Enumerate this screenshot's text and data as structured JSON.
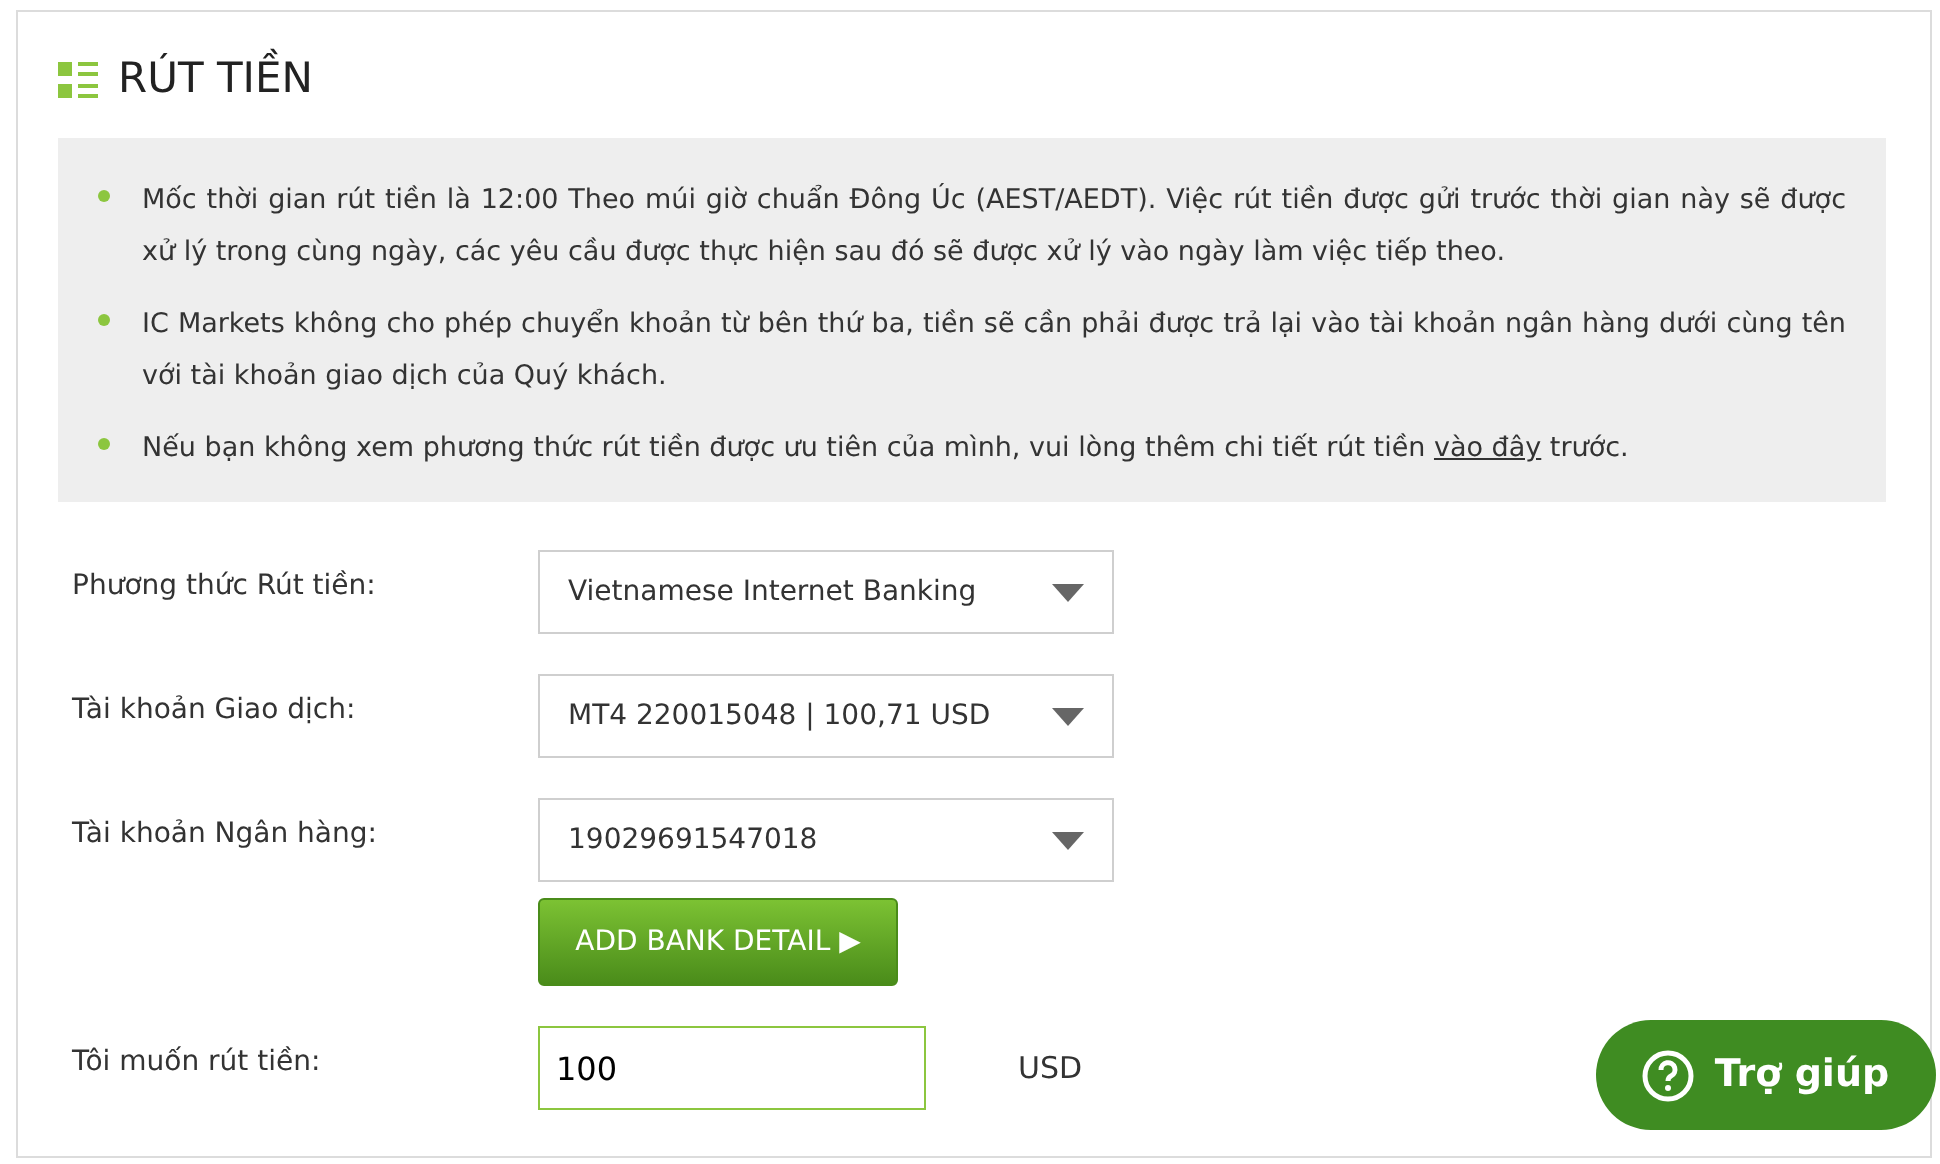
{
  "title": "RÚT TIỀN",
  "notes": [
    {
      "text": "Mốc thời gian rút tiền là 12:00 Theo múi giờ chuẩn Đông Úc (AEST/AEDT). Việc rút tiền được gửi trước thời gian này sẽ được xử lý trong cùng ngày, các yêu cầu được thực hiện sau đó sẽ được xử lý vào ngày làm việc tiếp theo."
    },
    {
      "text": "IC Markets không cho phép chuyển khoản từ bên thứ ba, tiền sẽ cần phải được trả lại vào tài khoản ngân hàng dưới cùng tên với tài khoản giao dịch của Quý khách."
    },
    {
      "text": "Nếu bạn không xem phương thức rút tiền được ưu tiên của mình, vui lòng thêm chi tiết rút tiền ",
      "link": "vào đây",
      "after": " trước."
    }
  ],
  "fields": [
    {
      "kind": "select",
      "label": "Phương thức Rút tiền:",
      "value": "Vietnamese Internet Banking"
    },
    {
      "kind": "select",
      "label": "Tài khoản Giao dịch:",
      "value": "MT4 220015048 | 100,71 USD"
    },
    {
      "kind": "select",
      "label": "Tài khoản Ngân hàng:",
      "value": "19029691547018",
      "button": "ADD BANK DETAIL ▶"
    },
    {
      "kind": "input",
      "label": "Tôi muốn rút tiền:",
      "value": "100",
      "unit": "USD"
    }
  ],
  "help_button": "Trợ giúp"
}
